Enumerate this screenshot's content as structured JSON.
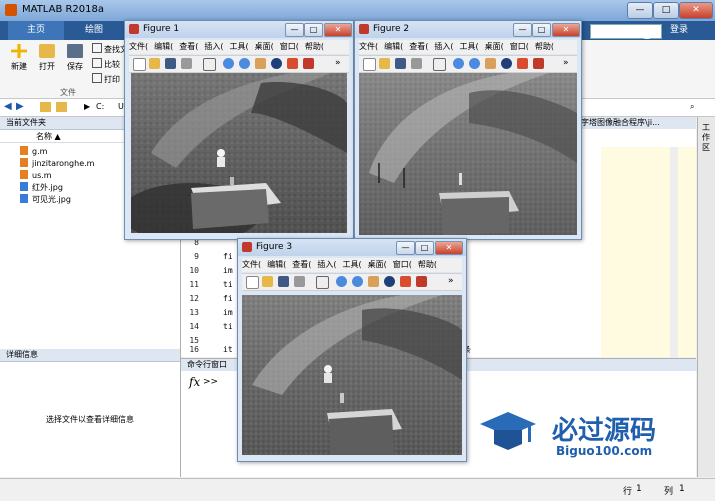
{
  "app": {
    "title": "MATLAB R2018a"
  },
  "ribbon_tabs": [
    "主页",
    "绘图"
  ],
  "ribbon": {
    "new": "新建",
    "open": "打开",
    "save": "保存",
    "find_files": "查找文",
    "compare": "比较",
    "print": "打印",
    "section": "文件"
  },
  "search_placeholder": "搜索",
  "search_right": "登录",
  "address": {
    "path": "C:",
    "tail": "U",
    "right_path": "字塔图像融合程序\\ji..."
  },
  "current_folder": {
    "title": "当前文件夹",
    "column_header": "名称 ▲",
    "files": [
      "g.m",
      "jinzitaronghe.m",
      "us.m",
      "红外.jpg",
      "可见光.jpg"
    ]
  },
  "details": {
    "title": "详细信息",
    "message": "选择文件以查看详细信息"
  },
  "editor": {
    "lines": [
      {
        "n": "8",
        "code": ""
      },
      {
        "n": "9",
        "code": "fi"
      },
      {
        "n": "10",
        "code": "im"
      },
      {
        "n": "11",
        "code": "ti"
      },
      {
        "n": "12",
        "code": "fi"
      },
      {
        "n": "13",
        "code": "im"
      },
      {
        "n": "14",
        "code": "ti"
      },
      {
        "n": "15",
        "code": ""
      },
      {
        "n": "16",
        "code": "it"
      }
    ],
    "tail_text": "条"
  },
  "command_window": {
    "title": "命令行窗口",
    "prompt": ">>"
  },
  "right_strip_label": "工作区",
  "status": {
    "row_label": "行",
    "row": "1",
    "col_label": "列",
    "col": "1"
  },
  "figures": [
    {
      "title": "Figure 1",
      "menu": [
        "文件(",
        "编辑(",
        "查看(",
        "插入(",
        "工具(",
        "桌面(",
        "窗口(",
        "帮助("
      ]
    },
    {
      "title": "Figure 2",
      "menu": [
        "文件(",
        "编辑(",
        "查看(",
        "插入(",
        "工具(",
        "桌面(",
        "窗口(",
        "帮助("
      ]
    },
    {
      "title": "Figure 3",
      "menu": [
        "文件(",
        "编辑(",
        "查看(",
        "插入(",
        "工具(",
        "桌面(",
        "窗口(",
        "帮助("
      ]
    }
  ],
  "watermark": {
    "text": "必过源码",
    "url": "Biguo100.com"
  }
}
